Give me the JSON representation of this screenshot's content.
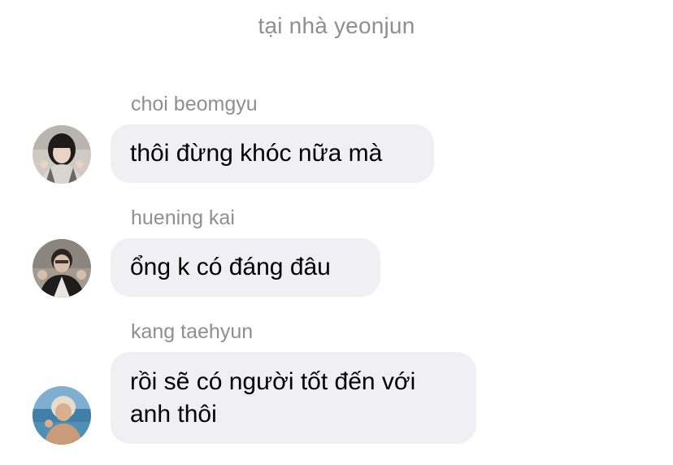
{
  "chat": {
    "title": "tại nhà yeonjun",
    "messages": [
      {
        "sender": "choi beomgyu",
        "text": "thôi đừng khóc nữa mà"
      },
      {
        "sender": "huening kai",
        "text": "ổng k có đáng đâu"
      },
      {
        "sender": "kang taehyun",
        "lines": [
          "rồi sẽ có người tốt đến với",
          "anh thôi"
        ]
      }
    ]
  },
  "colors": {
    "bubble": "#efeff4",
    "sender_text": "#8e8e93",
    "header_text": "#8e8e93"
  }
}
